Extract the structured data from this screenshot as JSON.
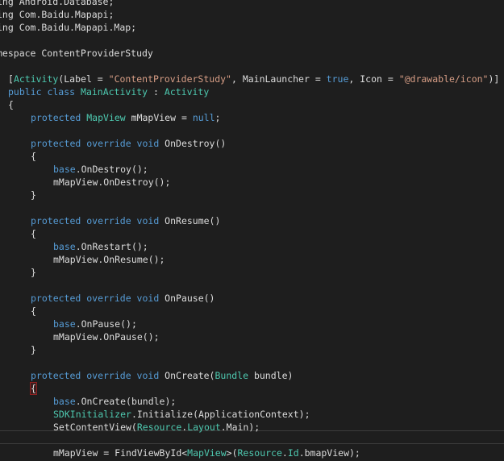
{
  "editor": {
    "colors": {
      "background": "#1e1e1e",
      "keyword": "#569cd6",
      "type": "#4ec9b0",
      "string": "#d69d85",
      "text": "#dcdcdc",
      "brace_match": "#8f2020"
    },
    "lines": [
      {
        "indent": 0,
        "tokens": [
          {
            "t": "plain",
            "v": "ing Android.Database;"
          }
        ]
      },
      {
        "indent": 0,
        "tokens": [
          {
            "t": "plain",
            "v": "ing Com.Baidu.Mapapi;"
          }
        ]
      },
      {
        "indent": 0,
        "tokens": [
          {
            "t": "plain",
            "v": "ing Com.Baidu.Mapapi.Map;"
          }
        ]
      },
      {
        "indent": 0,
        "tokens": []
      },
      {
        "indent": 0,
        "tokens": [
          {
            "t": "plain",
            "v": "mespace ContentProviderStudy"
          }
        ]
      },
      {
        "indent": 0,
        "tokens": []
      },
      {
        "indent": 1,
        "tokens": [
          {
            "t": "plain",
            "v": "["
          },
          {
            "t": "type",
            "v": "Activity"
          },
          {
            "t": "plain",
            "v": "(Label = "
          },
          {
            "t": "str",
            "v": "\"ContentProviderStudy\""
          },
          {
            "t": "plain",
            "v": ", MainLauncher = "
          },
          {
            "t": "kw",
            "v": "true"
          },
          {
            "t": "plain",
            "v": ", Icon = "
          },
          {
            "t": "str",
            "v": "\"@drawable/icon\""
          },
          {
            "t": "plain",
            "v": ")]"
          }
        ]
      },
      {
        "indent": 1,
        "tokens": [
          {
            "t": "kw",
            "v": "public class "
          },
          {
            "t": "type",
            "v": "MainActivity"
          },
          {
            "t": "plain",
            "v": " : "
          },
          {
            "t": "type",
            "v": "Activity"
          }
        ]
      },
      {
        "indent": 1,
        "tokens": [
          {
            "t": "plain",
            "v": "{"
          }
        ]
      },
      {
        "indent": 2,
        "tokens": [
          {
            "t": "kw",
            "v": "protected "
          },
          {
            "t": "type",
            "v": "MapView"
          },
          {
            "t": "plain",
            "v": " mMapView = "
          },
          {
            "t": "kw",
            "v": "null"
          },
          {
            "t": "plain",
            "v": ";"
          }
        ]
      },
      {
        "indent": 0,
        "tokens": []
      },
      {
        "indent": 2,
        "tokens": [
          {
            "t": "kw",
            "v": "protected override void "
          },
          {
            "t": "plain",
            "v": "OnDestroy()"
          }
        ]
      },
      {
        "indent": 2,
        "tokens": [
          {
            "t": "plain",
            "v": "{"
          }
        ]
      },
      {
        "indent": 3,
        "tokens": [
          {
            "t": "kw",
            "v": "base"
          },
          {
            "t": "plain",
            "v": ".OnDestroy();"
          }
        ]
      },
      {
        "indent": 3,
        "tokens": [
          {
            "t": "plain",
            "v": "mMapView.OnDestroy();"
          }
        ]
      },
      {
        "indent": 2,
        "tokens": [
          {
            "t": "plain",
            "v": "}"
          }
        ]
      },
      {
        "indent": 0,
        "tokens": []
      },
      {
        "indent": 2,
        "tokens": [
          {
            "t": "kw",
            "v": "protected override void "
          },
          {
            "t": "plain",
            "v": "OnResume()"
          }
        ]
      },
      {
        "indent": 2,
        "tokens": [
          {
            "t": "plain",
            "v": "{"
          }
        ]
      },
      {
        "indent": 3,
        "tokens": [
          {
            "t": "kw",
            "v": "base"
          },
          {
            "t": "plain",
            "v": ".OnRestart();"
          }
        ]
      },
      {
        "indent": 3,
        "tokens": [
          {
            "t": "plain",
            "v": "mMapView.OnResume();"
          }
        ]
      },
      {
        "indent": 2,
        "tokens": [
          {
            "t": "plain",
            "v": "}"
          }
        ]
      },
      {
        "indent": 0,
        "tokens": []
      },
      {
        "indent": 2,
        "tokens": [
          {
            "t": "kw",
            "v": "protected override void "
          },
          {
            "t": "plain",
            "v": "OnPause()"
          }
        ]
      },
      {
        "indent": 2,
        "tokens": [
          {
            "t": "plain",
            "v": "{"
          }
        ]
      },
      {
        "indent": 3,
        "tokens": [
          {
            "t": "kw",
            "v": "base"
          },
          {
            "t": "plain",
            "v": ".OnPause();"
          }
        ]
      },
      {
        "indent": 3,
        "tokens": [
          {
            "t": "plain",
            "v": "mMapView.OnPause();"
          }
        ]
      },
      {
        "indent": 2,
        "tokens": [
          {
            "t": "plain",
            "v": "}"
          }
        ]
      },
      {
        "indent": 0,
        "tokens": []
      },
      {
        "indent": 2,
        "tokens": [
          {
            "t": "kw",
            "v": "protected override void "
          },
          {
            "t": "plain",
            "v": "OnCreate("
          },
          {
            "t": "type",
            "v": "Bundle"
          },
          {
            "t": "plain",
            "v": " bundle)"
          }
        ]
      },
      {
        "indent": 2,
        "brace_match": true,
        "tokens": [
          {
            "t": "plain",
            "v": "{"
          }
        ]
      },
      {
        "indent": 3,
        "tokens": [
          {
            "t": "kw",
            "v": "base"
          },
          {
            "t": "plain",
            "v": ".OnCreate(bundle);"
          }
        ]
      },
      {
        "indent": 3,
        "tokens": [
          {
            "t": "type",
            "v": "SDKInitializer"
          },
          {
            "t": "plain",
            "v": ".Initialize(ApplicationContext);"
          }
        ]
      },
      {
        "indent": 3,
        "tokens": [
          {
            "t": "plain",
            "v": "SetContentView("
          },
          {
            "t": "type",
            "v": "Resource"
          },
          {
            "t": "plain",
            "v": "."
          },
          {
            "t": "type",
            "v": "Layout"
          },
          {
            "t": "plain",
            "v": ".Main);"
          }
        ]
      },
      {
        "indent": 0,
        "current": true,
        "tokens": []
      },
      {
        "indent": 3,
        "tokens": [
          {
            "t": "plain",
            "v": "mMapView = FindViewById<"
          },
          {
            "t": "type",
            "v": "MapView"
          },
          {
            "t": "plain",
            "v": ">("
          },
          {
            "t": "type",
            "v": "Resource"
          },
          {
            "t": "plain",
            "v": "."
          },
          {
            "t": "type",
            "v": "Id"
          },
          {
            "t": "plain",
            "v": ".bmapView);"
          }
        ]
      }
    ]
  }
}
